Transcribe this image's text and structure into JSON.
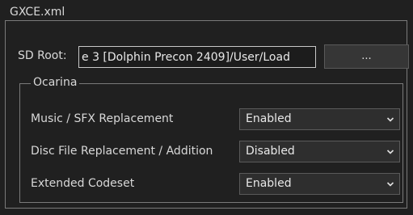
{
  "xml_group": {
    "title": "GXCE.xml"
  },
  "sd_root": {
    "label": "SD Root:",
    "value": "e 3 [Dolphin Precon 2409]/User/Load",
    "browse_label": "..."
  },
  "ocarina": {
    "title": "Ocarina",
    "rows": [
      {
        "label": "Music / SFX Replacement",
        "value": "Enabled"
      },
      {
        "label": "Disc File Replacement / Addition",
        "value": "Disabled"
      },
      {
        "label": "Extended Codeset",
        "value": "Enabled"
      }
    ]
  },
  "colors": {
    "background": "#202020",
    "border": "#7a7a7a",
    "text": "#d8d8d8"
  },
  "icons": {
    "dropdown": "chevron-down-icon"
  }
}
